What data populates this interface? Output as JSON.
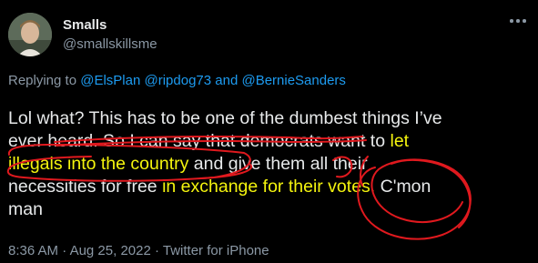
{
  "author": {
    "display_name": "Smalls",
    "handle": "@smallskillsme"
  },
  "reply": {
    "prefix": "Replying to ",
    "mention_1": "@ElsPlan",
    "mention_2": "@ripdog73",
    "conjunction": " and ",
    "mention_3": "@BernieSanders"
  },
  "tweet": {
    "line_1": "Lol what? This has to be one of the dumbest things I’ve",
    "line_2_plain": "ever heard. So I can say that democrats want to ",
    "line_2_hl": "let",
    "line_3_hl": "illegals into the country",
    "line_3_plain": " and give them all their",
    "line_4_plain": "necessities for free ",
    "line_4_hl": "in exchange for their votes.",
    "line_4_tail": "  C'mon",
    "line_5": "man"
  },
  "meta": {
    "time": "8:36 AM",
    "separator": " · ",
    "date": "Aug 25, 2022",
    "source": "Twitter for iPhone"
  },
  "colors": {
    "background": "#000000",
    "text": "#e7e9ea",
    "secondary": "#8b98a5",
    "link": "#1d9bf0",
    "highlight": "#f4f40e",
    "annotation": "#e0191e"
  },
  "icons": {
    "more": "more-options-icon"
  }
}
